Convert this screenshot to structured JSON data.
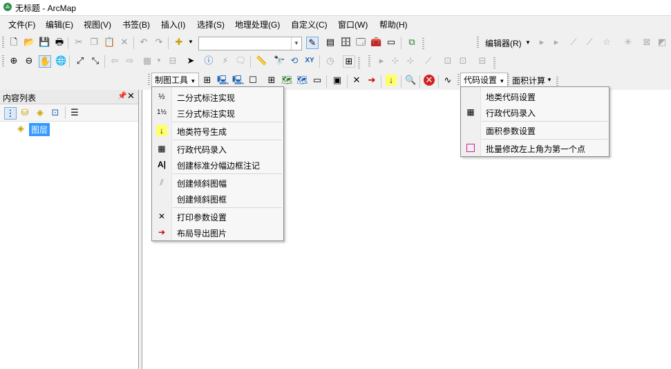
{
  "window": {
    "title": "无标题 - ArcMap"
  },
  "menubar": {
    "items": [
      "文件(F)",
      "编辑(E)",
      "视图(V)",
      "书签(B)",
      "插入(I)",
      "选择(S)",
      "地理处理(G)",
      "自定义(C)",
      "窗口(W)",
      "帮助(H)"
    ]
  },
  "toolbar": {
    "editor_label": "编辑器(R)",
    "mapping_tools_label": "制图工具",
    "code_settings_label": "代码设置",
    "area_calc_label": "面积计算"
  },
  "toc": {
    "title": "内容列表",
    "layer_label": "图层"
  },
  "mapping_menu": {
    "items": [
      {
        "label": "二分式标注实现",
        "icon": "fraction-half-icon"
      },
      {
        "label": "三分式标注实现",
        "icon": "mixed-fraction-icon"
      },
      {
        "label": "地类符号生成",
        "icon": "yellow-down-arrow-icon"
      },
      {
        "label": "行政代码录入",
        "icon": "grid-table-icon"
      },
      {
        "label": "创建标准分幅边框注记",
        "icon": "text-a-icon"
      },
      {
        "label": "创建倾斜图幅",
        "icon": "diagonal-lines-icon"
      },
      {
        "label": "创建倾斜图框",
        "icon": ""
      },
      {
        "label": "打印参数设置",
        "icon": "cross-tools-icon"
      },
      {
        "label": "布局导出图片",
        "icon": "export-image-icon"
      }
    ]
  },
  "code_menu": {
    "items": [
      {
        "label": "地类代码设置",
        "icon": ""
      },
      {
        "label": "行政代码录入",
        "icon": "grid-table-icon"
      },
      {
        "label": "面积参数设置",
        "icon": ""
      },
      {
        "label": "批量修改左上角为第一个点",
        "icon": "magenta-square-icon"
      }
    ]
  }
}
